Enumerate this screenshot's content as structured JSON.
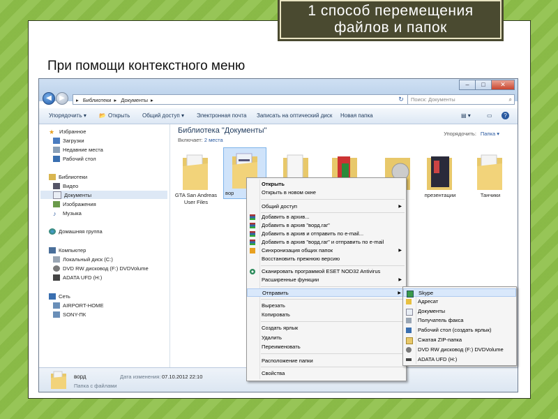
{
  "slide": {
    "title_line1": "1 способ перемещения",
    "title_line2": "файлов и папок",
    "caption": "При помощи контекстного меню"
  },
  "explorer": {
    "address": [
      "Библиотеки",
      "Документы"
    ],
    "search_placeholder": "Поиск: Документы",
    "toolbar": {
      "organize": "Упорядочить ▾",
      "open": "Открыть",
      "share": "Общий доступ ▾",
      "email": "Электронная почта",
      "burn": "Записать на оптический диск",
      "new_folder": "Новая папка"
    },
    "sidebar": {
      "favorites": "Избранное",
      "downloads": "Загрузки",
      "recent": "Недавние места",
      "desktop": "Рабочий стол",
      "libraries": "Библиотеки",
      "video": "Видео",
      "documents": "Документы",
      "images": "Изображения",
      "music": "Музыка",
      "homegroup": "Домашняя группа",
      "computer": "Компьютер",
      "local_disk": "Локальный диск (C:)",
      "dvd": "DVD RW дисковод (F:) DVDVolume",
      "adata": "ADATA UFD (H:)",
      "network": "Сеть",
      "airport": "AIRPORT-HOME",
      "sony": "SONY-ПК"
    },
    "library": {
      "title": "Библиотека \"Документы\"",
      "includes_label": "Включает:",
      "includes_link": "2 места",
      "arrange_label": "Упорядочить:",
      "arrange_value": "Папка ▾"
    },
    "folders": {
      "f1": "GTA San Andreas User Files",
      "f2": "вор",
      "f7": "презентации",
      "f8": "Танчики"
    },
    "status": {
      "name": "ворд",
      "modified_label": "Дата изменения:",
      "modified_value": "07.10.2012 22:10",
      "type": "Папка с файлами"
    }
  },
  "context_menu": {
    "open": "Открыть",
    "open_new": "Открыть в новом окне",
    "share": "Общий доступ",
    "add_archive": "Добавить в архив...",
    "add_rar": "Добавить в архив \"ворд.rar\"",
    "add_email": "Добавить в архив и отправить по e-mail...",
    "add_rar_email": "Добавить в архив \"ворд.rar\" и отправить по e-mail",
    "sync": "Синхронизация общих папок",
    "restore": "Восстановить прежнюю версию",
    "eset": "Сканировать программой ESET NOD32 Antivirus",
    "advanced": "Расширенные функции",
    "send_to": "Отправить",
    "cut": "Вырезать",
    "copy": "Копировать",
    "shortcut": "Создать ярлык",
    "delete": "Удалить",
    "rename": "Переименовать",
    "location": "Расположение папки",
    "properties": "Свойства"
  },
  "send_to_menu": {
    "skype": "Skype",
    "recipient": "Адресат",
    "documents": "Документы",
    "fax": "Получатель факса",
    "desktop": "Рабочий стол (создать ярлык)",
    "zip": "Сжатая ZIP-папка",
    "dvd": "DVD RW дисковод (F:) DVDVolume",
    "adata": "ADATA UFD (H:)"
  },
  "colors": {
    "background": "#8fc14a",
    "title_box": "#4a4a30",
    "highlight": "#d9e8fb",
    "link": "#2a5aa0"
  }
}
